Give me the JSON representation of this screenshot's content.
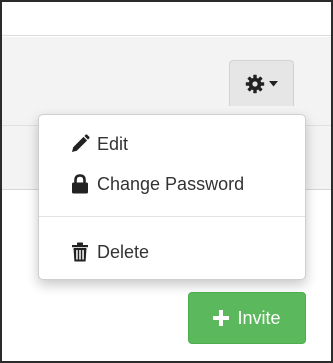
{
  "dropdown": {
    "items": [
      {
        "label": "Edit",
        "icon": "pencil-icon"
      },
      {
        "label": "Change Password",
        "icon": "lock-icon"
      },
      {
        "label": "Delete",
        "icon": "trash-icon"
      }
    ]
  },
  "toolbar": {
    "gear_icon": "gear-icon",
    "caret_icon": "caret-down-icon"
  },
  "invite_button": {
    "label": "Invite",
    "icon": "plus-icon",
    "color": "#5cb85c"
  }
}
